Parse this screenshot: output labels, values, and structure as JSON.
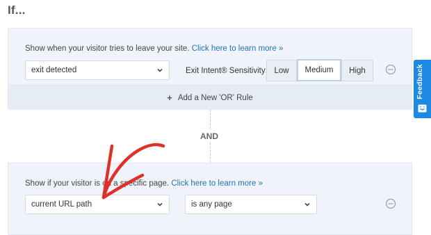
{
  "heading": "If...",
  "rule1": {
    "description": "Show when your visitor tries to leave your site.",
    "link": "Click here to learn more »",
    "condition": "exit detected",
    "sensitivity_label": "Exit Intent® Sensitivity:",
    "sensitivity_options": [
      "Low",
      "Medium",
      "High"
    ],
    "sensitivity_selected": "Medium",
    "add_or_rule": "Add a New 'OR' Rule"
  },
  "and_label": "AND",
  "rule2": {
    "description": "Show if your visitor is on a specific page.",
    "link": "Click here to learn more »",
    "condition": "current URL path",
    "operator": "is any page"
  },
  "feedback_tab": "Feedback",
  "colors": {
    "link": "#1e73be",
    "feedback": "#1e88e5",
    "annotation_arrow": "#e0302a",
    "panel_bg": "#f0f4fa"
  },
  "icons": [
    "chevron-down-icon",
    "remove-rule-icon",
    "plus-icon",
    "feedback-icon",
    "annotation-arrow"
  ]
}
